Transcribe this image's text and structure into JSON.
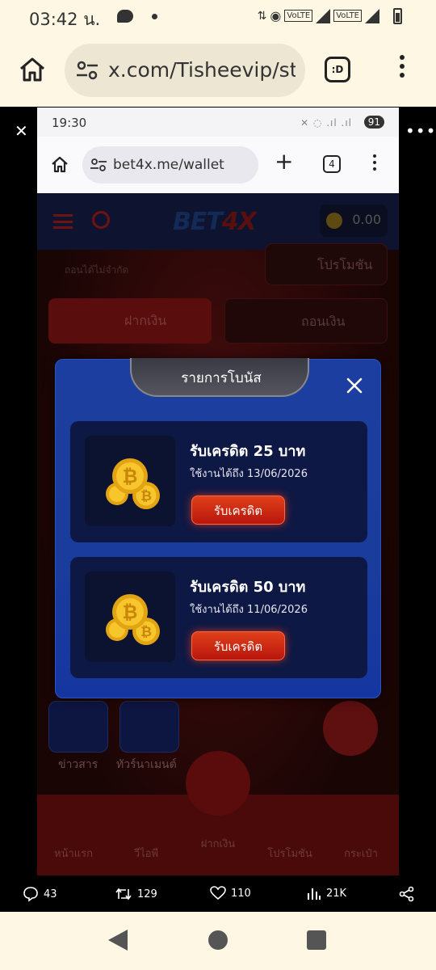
{
  "outer_status": {
    "time": "03:42 น.",
    "volte1": "VoLTE",
    "volte2": "VoLTE"
  },
  "outer_browser": {
    "url": "x.com/Tisheevip/st",
    "tabs_label": ":D"
  },
  "inner_status": {
    "time": "19:30",
    "battery": "91"
  },
  "inner_browser": {
    "url": "bet4x.me/wallet",
    "tab_count": "4"
  },
  "site": {
    "logo_main": "BET",
    "logo_accent": "4X",
    "balance": "0.00",
    "withdraw_unlimited": "ถอนได้ไม่จำกัด",
    "promo_button": "โปรโมชัน",
    "deposit_button": "ฝากเงิน",
    "withdraw_button": "ถอนเงิน",
    "news_label": "ข่าวสาร",
    "tournament_label": "ทัวร์นาเมนต์",
    "bottom_tabs": [
      "หน้าแรก",
      "วีไอพี",
      "ฝากเงิน",
      "โปรโมชัน",
      "กระเป๋า"
    ]
  },
  "modal": {
    "title": "รายการโบนัส",
    "items": [
      {
        "title": "รับเครดิต 25 บาท",
        "expiry": "ใช้งานได้ถึง 13/06/2026",
        "button": "รับเครดิต"
      },
      {
        "title": "รับเครดิต 50 บาท",
        "expiry": "ใช้งานได้ถึง 11/06/2026",
        "button": "รับเครดิต"
      }
    ]
  },
  "x_actions": {
    "replies": "43",
    "reposts": "129",
    "likes": "110",
    "views": "21K"
  }
}
